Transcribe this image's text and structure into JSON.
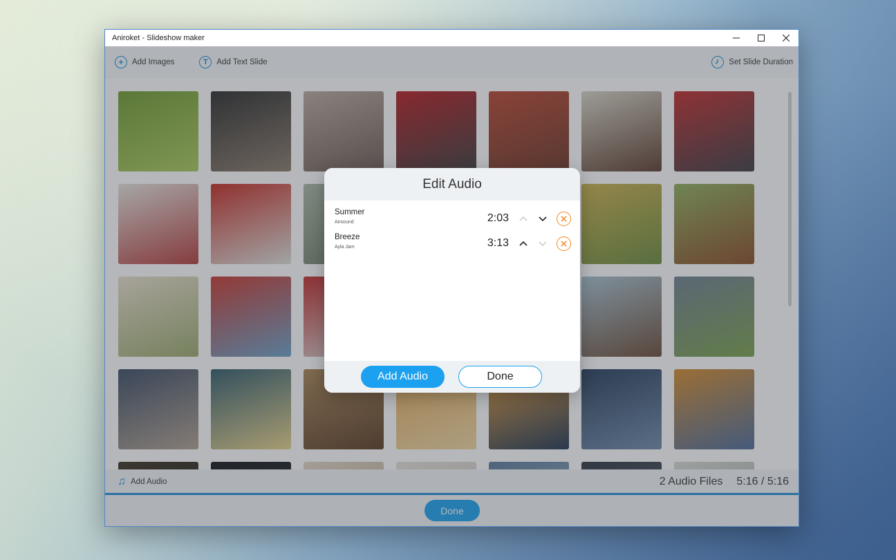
{
  "window": {
    "title": "Aniroket - Slideshow maker",
    "controls": [
      "minimize-icon",
      "maximize-icon",
      "close-icon"
    ]
  },
  "toolbar": {
    "add_images": "Add Images",
    "add_text_slide": "Add Text Slide",
    "set_slide_duration": "Set Slide Duration"
  },
  "footer": {
    "add_audio": "Add Audio",
    "audio_count": "2 Audio Files",
    "duration": "5:16 / 5:16",
    "progress_percent": 100,
    "done": "Done"
  },
  "dialog": {
    "title": "Edit Audio",
    "tracks": [
      {
        "name": "Summer",
        "artist": "Airsound",
        "time": "2:03",
        "up_enabled": false,
        "down_enabled": true
      },
      {
        "name": "Breeze",
        "artist": "Ayla Jam",
        "time": "3:13",
        "up_enabled": true,
        "down_enabled": false
      }
    ],
    "add_audio_button": "Add Audio",
    "done_button": "Done"
  },
  "colors": {
    "accent": "#1ba1ef",
    "remove": "#f2891e"
  },
  "thumbnails": [
    {
      "subject": "guitar-in-grass",
      "colors": [
        "#6f9a2e",
        "#a9c95a"
      ]
    },
    {
      "subject": "vintage-camera",
      "colors": [
        "#2a2a2a",
        "#8a7a6a"
      ]
    },
    {
      "subject": "holding-hands",
      "colors": [
        "#b9a99c",
        "#6b5a52"
      ]
    },
    {
      "subject": "red-rose",
      "colors": [
        "#b51a1f",
        "#3a3a3a"
      ]
    },
    {
      "subject": "red-crate-shelf",
      "colors": [
        "#b8442e",
        "#6a3424"
      ]
    },
    {
      "subject": "signing-document",
      "colors": [
        "#d8d4c6",
        "#5a3a2a"
      ]
    },
    {
      "subject": "wedding-toast",
      "colors": [
        "#c02a2a",
        "#3a3a40"
      ]
    },
    {
      "subject": "ring-pillow",
      "colors": [
        "#e8e4de",
        "#b23a3a"
      ]
    },
    {
      "subject": "red-vintage-car",
      "colors": [
        "#c4281f",
        "#dfe0dc"
      ]
    },
    {
      "subject": "landscape",
      "colors": [
        "#a9b7a5",
        "#6c7b62"
      ]
    },
    {
      "subject": "hidden",
      "colors": [
        "#cccccc",
        "#aaaaaa"
      ]
    },
    {
      "subject": "hidden",
      "colors": [
        "#cccccc",
        "#aaaaaa"
      ]
    },
    {
      "subject": "wheat-field",
      "colors": [
        "#c9b04a",
        "#6b8a3a"
      ]
    },
    {
      "subject": "leather-bag-on-road",
      "colors": [
        "#8fae5a",
        "#8a4a24"
      ]
    },
    {
      "subject": "open-notebook",
      "colors": [
        "#e8e0cc",
        "#9aa86a"
      ]
    },
    {
      "subject": "football-helmet",
      "colors": [
        "#c8362c",
        "#6aa0c8"
      ]
    },
    {
      "subject": "person-partial",
      "colors": [
        "#c02a2a",
        "#dcdcdc"
      ]
    },
    {
      "subject": "hidden",
      "colors": [
        "#cccccc",
        "#aaaaaa"
      ]
    },
    {
      "subject": "hidden",
      "colors": [
        "#cccccc",
        "#aaaaaa"
      ]
    },
    {
      "subject": "jumping-person",
      "colors": [
        "#a7c1cf",
        "#6a4a34"
      ]
    },
    {
      "subject": "field-storm-clouds",
      "colors": [
        "#6e7f90",
        "#7aa04a"
      ]
    },
    {
      "subject": "flannel-shirt",
      "colors": [
        "#3a4a62",
        "#b0a090"
      ]
    },
    {
      "subject": "water-lily",
      "colors": [
        "#2e5a6a",
        "#e9d38a"
      ]
    },
    {
      "subject": "dry-grass",
      "colors": [
        "#a88454",
        "#5a3a22"
      ]
    },
    {
      "subject": "puppy-cuddle",
      "colors": [
        "#e3a95a",
        "#f1d7a0"
      ]
    },
    {
      "subject": "sunset-beach",
      "colors": [
        "#e59a3a",
        "#1e3550"
      ]
    },
    {
      "subject": "reading-in-car",
      "colors": [
        "#243a5a",
        "#6e8aa8"
      ]
    },
    {
      "subject": "autumn-road",
      "colors": [
        "#d48a2a",
        "#4a6a9a"
      ]
    },
    {
      "subject": "dark-photo",
      "colors": [
        "#3a3022",
        "#1a1a1a"
      ]
    },
    {
      "subject": "dark-photo",
      "colors": [
        "#101418",
        "#2a2e34"
      ]
    },
    {
      "subject": "light-photo",
      "colors": [
        "#e2d6c4",
        "#a89680"
      ]
    },
    {
      "subject": "light-photo",
      "colors": [
        "#e6e2dc",
        "#c4bcb0"
      ]
    },
    {
      "subject": "blue-photo",
      "colors": [
        "#5a7a9a",
        "#a8bccc"
      ]
    },
    {
      "subject": "dark-photo",
      "colors": [
        "#2c3440",
        "#5a6070"
      ]
    },
    {
      "subject": "landscape",
      "colors": [
        "#d8dcd6",
        "#8a9a88"
      ]
    }
  ]
}
